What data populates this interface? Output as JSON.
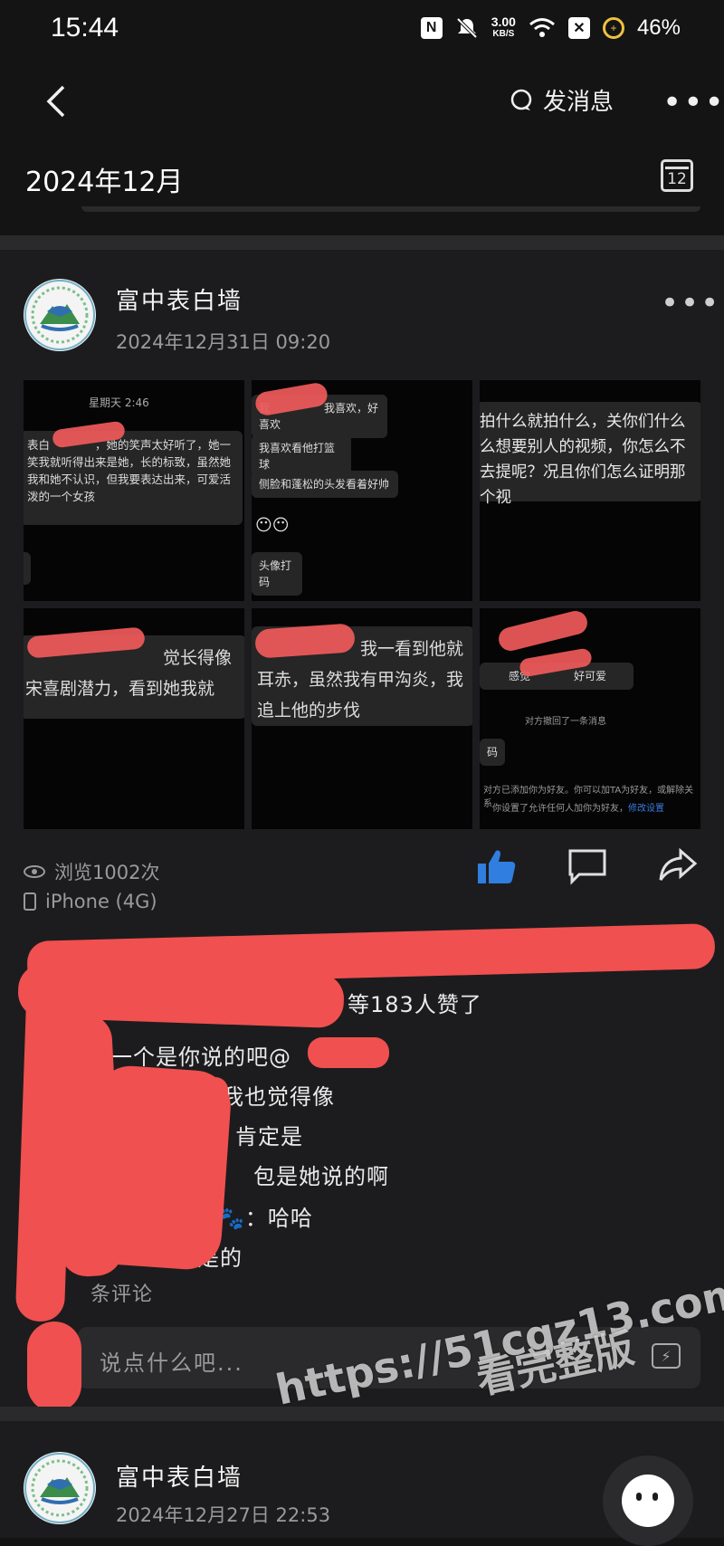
{
  "status_bar": {
    "time": "15:44",
    "nfc": "N",
    "net_speed_value": "3.00",
    "net_speed_unit": "KB/S",
    "battery": "46%"
  },
  "top_bar": {
    "post_message_label": "发消息",
    "month": "2024年12月",
    "calendar_day": "12"
  },
  "post1": {
    "author": "富中表白墙",
    "time": "2024年12月31日 09:20",
    "images": {
      "t1": {
        "header": "星期天 2:46",
        "text": "表白　　　　，她的笑声太好听了，她一笑我就听得出来是她，长的标致，虽然她我和她不认识，但我要表达出来，可爱活泼的一个女孩"
      },
      "t2": {
        "line1": "我　　　　　我喜欢，好喜欢",
        "line2": "我喜欢看他打篮球",
        "line3": "侧脸和蓬松的头发看着好帅",
        "emoji": "😶😶",
        "line4": "头像打码"
      },
      "t3": {
        "text": "拍什么就拍什么，关你们什么么想要别人的视频，你怎么不去提呢？况且你们怎么证明那个视"
      },
      "t4": {
        "text": "　　　　　　　　觉长得像宋喜剧潜力，看到她我就"
      },
      "t5": {
        "text": "　　　　　　我一看到他就耳赤，虽然我有甲沟炎，我追上他的步伐"
      },
      "t6": {
        "line1": "　　感觉　　　　好可爱",
        "line2": "对方撤回了一条消息",
        "line3": "码",
        "line4": "对方已添加你为好友。你可以加TA为好友，或解除关系",
        "line5": "你设置了允许任何人加你为好友，",
        "line5_link": "修改设置"
      }
    },
    "views": "浏览1002次",
    "device": "iPhone (4G)",
    "likes_text": "等183人赞了",
    "comments": [
      "最后一个是你说的吧@",
      "回　　　：我也觉得像",
      "肯定是",
      "包是她说的啊",
      "：哈哈",
      "是的"
    ],
    "all_comments": "条评论",
    "input_placeholder": "说点什么吧..."
  },
  "post2": {
    "author": "富中表白墙",
    "time": "2024年12月27日 22:53"
  },
  "watermark": {
    "line1": "https://51cgz13.com",
    "line2": "看完整版"
  },
  "colors": {
    "background": "#141414",
    "card": "#1c1c1e",
    "like_blue": "#2f7ee0",
    "mask_red": "#f0504f"
  }
}
